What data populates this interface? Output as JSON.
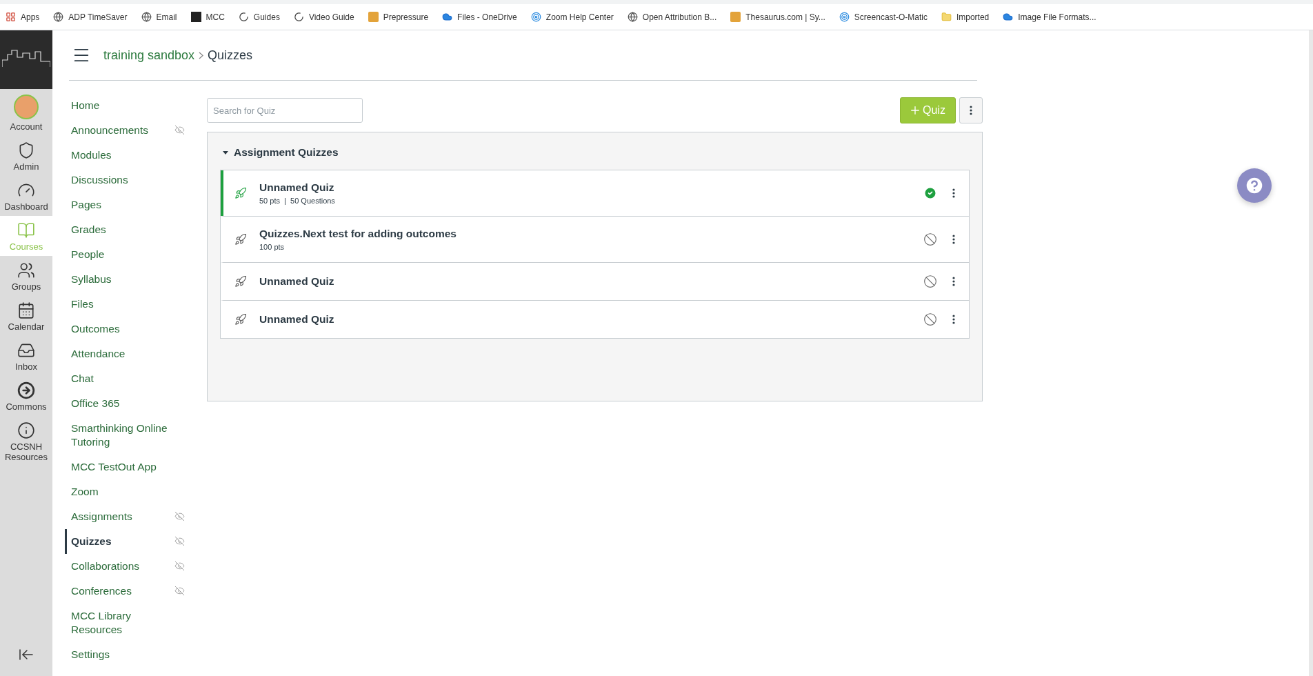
{
  "bookmarks": [
    {
      "kind": "apps",
      "label": "Apps"
    },
    {
      "kind": "globe",
      "label": "ADP TimeSaver"
    },
    {
      "kind": "globe",
      "label": "Email"
    },
    {
      "kind": "tile",
      "label": "MCC"
    },
    {
      "kind": "ring",
      "label": "Guides"
    },
    {
      "kind": "ring",
      "label": "Video Guide"
    },
    {
      "kind": "badge",
      "label": "Prepressure"
    },
    {
      "kind": "cloud",
      "label": "Files - OneDrive"
    },
    {
      "kind": "target",
      "label": "Zoom Help Center"
    },
    {
      "kind": "globe",
      "label": "Open Attribution B..."
    },
    {
      "kind": "badge",
      "label": "Thesaurus.com | Sy..."
    },
    {
      "kind": "target",
      "label": "Screencast-O-Matic"
    },
    {
      "kind": "folder",
      "label": "Imported"
    },
    {
      "kind": "cloud",
      "label": "Image File Formats..."
    }
  ],
  "global_nav": [
    {
      "kind": "account",
      "label": "Account",
      "selected": false
    },
    {
      "kind": "admin",
      "label": "Admin",
      "selected": false
    },
    {
      "kind": "dashboard",
      "label": "Dashboard",
      "selected": false
    },
    {
      "kind": "courses",
      "label": "Courses",
      "selected": true
    },
    {
      "kind": "groups",
      "label": "Groups",
      "selected": false
    },
    {
      "kind": "calendar",
      "label": "Calendar",
      "selected": false
    },
    {
      "kind": "inbox",
      "label": "Inbox",
      "selected": false
    },
    {
      "kind": "commons",
      "label": "Commons",
      "selected": false
    },
    {
      "kind": "resources",
      "label": "CCSNH Resources",
      "selected": false
    }
  ],
  "breadcrumbs": [
    "training sandbox",
    "Quizzes"
  ],
  "course_nav": [
    {
      "label": "Home",
      "hidden": false,
      "selected": false
    },
    {
      "label": "Announcements",
      "hidden": true,
      "selected": false
    },
    {
      "label": "Modules",
      "hidden": false,
      "selected": false
    },
    {
      "label": "Discussions",
      "hidden": false,
      "selected": false
    },
    {
      "label": "Pages",
      "hidden": false,
      "selected": false
    },
    {
      "label": "Grades",
      "hidden": false,
      "selected": false
    },
    {
      "label": "People",
      "hidden": false,
      "selected": false
    },
    {
      "label": "Syllabus",
      "hidden": false,
      "selected": false
    },
    {
      "label": "Files",
      "hidden": false,
      "selected": false
    },
    {
      "label": "Outcomes",
      "hidden": false,
      "selected": false
    },
    {
      "label": "Attendance",
      "hidden": false,
      "selected": false
    },
    {
      "label": "Chat",
      "hidden": false,
      "selected": false
    },
    {
      "label": "Office 365",
      "hidden": false,
      "selected": false
    },
    {
      "label": "Smarthinking Online Tutoring",
      "hidden": false,
      "selected": false
    },
    {
      "label": "MCC TestOut App",
      "hidden": false,
      "selected": false
    },
    {
      "label": "Zoom",
      "hidden": false,
      "selected": false
    },
    {
      "label": "Assignments",
      "hidden": true,
      "selected": false
    },
    {
      "label": "Quizzes",
      "hidden": true,
      "selected": true
    },
    {
      "label": "Collaborations",
      "hidden": true,
      "selected": false
    },
    {
      "label": "Conferences",
      "hidden": true,
      "selected": false
    },
    {
      "label": "MCC Library Resources",
      "hidden": false,
      "selected": false
    },
    {
      "label": "Settings",
      "hidden": false,
      "selected": false
    }
  ],
  "search": {
    "placeholder": "Search for Quiz"
  },
  "add_button": "Quiz",
  "group": {
    "title": "Assignment Quizzes",
    "expanded": true,
    "quizzes": [
      {
        "title": "Unnamed Quiz",
        "details": "50 pts  |  50 Questions",
        "published": true
      },
      {
        "title": "Quizzes.Next test for adding outcomes",
        "details": "100 pts",
        "published": false
      },
      {
        "title": "Unnamed Quiz",
        "published": false
      },
      {
        "title": "Unnamed Quiz",
        "published": false
      }
    ]
  }
}
